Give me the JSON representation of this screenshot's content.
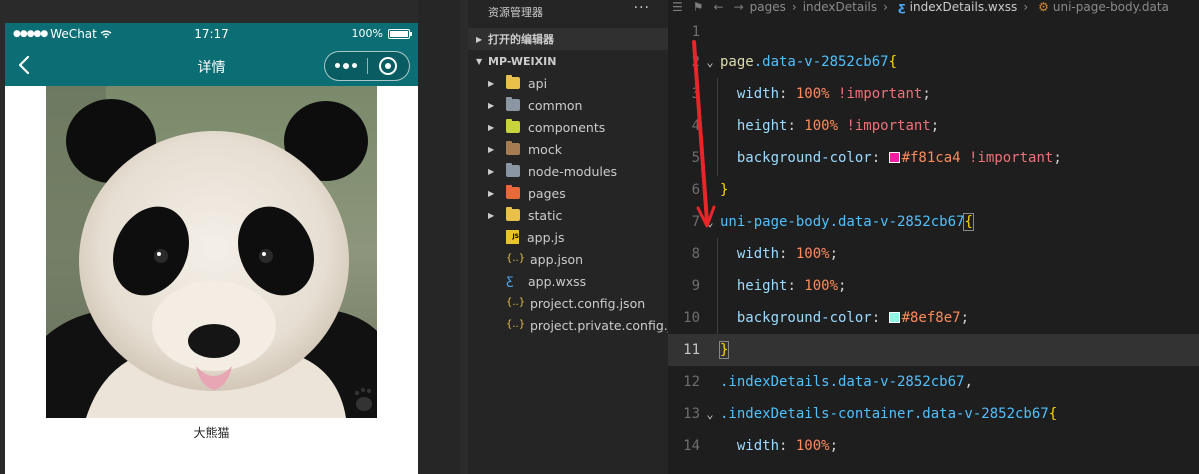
{
  "simulator": {
    "status_left": "WeChat",
    "status_time": "17:17",
    "status_battery": "100%",
    "nav_title": "详情",
    "caption": "大熊猫"
  },
  "explorer": {
    "title": "资源管理器",
    "menu": "···",
    "open_editors": "打开的编辑器",
    "root": "MP-WEIXIN",
    "folders": [
      {
        "name": "api",
        "color": "#e8c04a"
      },
      {
        "name": "common",
        "color": "#8a96a3"
      },
      {
        "name": "components",
        "color": "#c7d43a"
      },
      {
        "name": "mock",
        "color": "#a67c52"
      },
      {
        "name": "node-modules",
        "color": "#8a96a3"
      },
      {
        "name": "pages",
        "color": "#e86a3a"
      },
      {
        "name": "static",
        "color": "#e8c04a"
      }
    ],
    "files": [
      {
        "name": "app.js",
        "icon": "js-icon",
        "glyph": "JS"
      },
      {
        "name": "app.json",
        "icon": "json-icon",
        "glyph": "{..}"
      },
      {
        "name": "app.wxss",
        "icon": "css-icon",
        "glyph": "ƹ"
      },
      {
        "name": "project.config.json",
        "icon": "json-icon",
        "glyph": "{..}"
      },
      {
        "name": "project.private.config.js...",
        "icon": "json-icon",
        "glyph": "{..}"
      }
    ]
  },
  "editor": {
    "breadcrumb": {
      "folder1": "pages",
      "folder2": "indexDetails",
      "file": "indexDetails.wxss",
      "symbol": "uni-page-body.data"
    },
    "line_numbers": [
      "1",
      "2",
      "3",
      "4",
      "5",
      "6",
      "7",
      "8",
      "9",
      "10",
      "11",
      "12",
      "13",
      "14"
    ],
    "current_line": "11",
    "lines": {
      "l2_sel": "page",
      "l2_cls": ".data-v-2852cb67",
      "l3_prop": "width",
      "l3_val": "100%",
      "l3_imp": "!important",
      "l4_prop": "height",
      "l4_val": "100%",
      "l4_imp": "!important",
      "l5_prop": "background-color",
      "l5_val": "#f81ca4",
      "l5_imp": "!important",
      "l7_sel": "uni-page-body",
      "l7_cls": ".data-v-2852cb67",
      "l8_prop": "width",
      "l8_val": "100%",
      "l9_prop": "height",
      "l9_val": "100%",
      "l10_prop": "background-color",
      "l10_val": "#8ef8e7",
      "l12_cls": ".indexDetails.data-v-2852cb67",
      "l13_cls": ".indexDetails-container.data-v-2852cb67",
      "l14_prop": "width",
      "l14_val": "100%"
    },
    "swatches": {
      "pink": "#f81ca4",
      "mint": "#8ef8e7"
    }
  }
}
